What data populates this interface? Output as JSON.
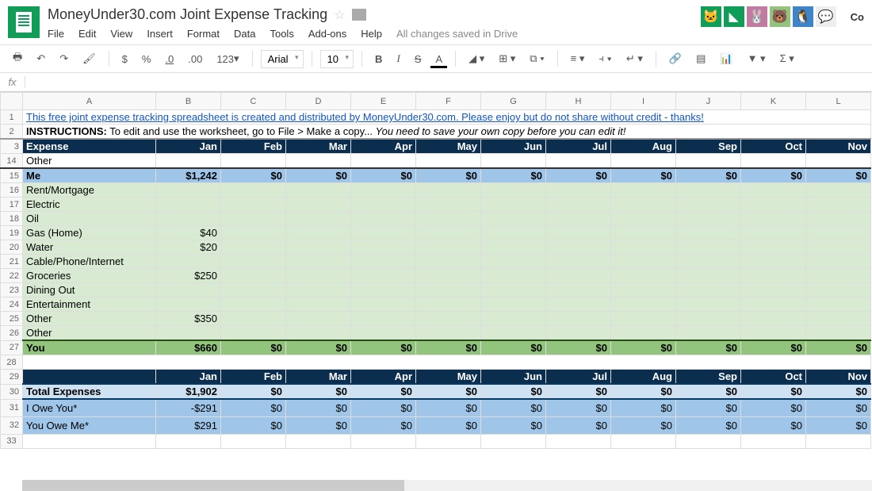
{
  "doc": {
    "title": "MoneyUnder30.com Joint Expense Tracking"
  },
  "menu": {
    "file": "File",
    "edit": "Edit",
    "view": "View",
    "insert": "Insert",
    "format": "Format",
    "data": "Data",
    "tools": "Tools",
    "addons": "Add-ons",
    "help": "Help",
    "status": "All changes saved in Drive"
  },
  "share": {
    "label": "Co"
  },
  "toolbar": {
    "currency": "$",
    "percent": "%",
    "dec0": ".0",
    "dec00": ".00",
    "fmt": "123",
    "font": "Arial",
    "size": "10",
    "bold": "B",
    "italic": "I",
    "strike": "S",
    "textcolor": "A"
  },
  "fx": {
    "label": "fx"
  },
  "columns": [
    "A",
    "B",
    "C",
    "D",
    "E",
    "F",
    "G",
    "H",
    "I",
    "J",
    "K",
    "L"
  ],
  "row1": {
    "link": "This free joint expense tracking spreadsheet is created and distributed by MoneyUnder30.com. Please enjoy but do not share without credit - thanks!"
  },
  "row2": {
    "bold": "INSTRUCTIONS:",
    "text": " To edit and use the worksheet, go to File > Make a copy...   ",
    "italic": "You need to save your own copy before you can edit it!"
  },
  "months": [
    "Jan",
    "Feb",
    "Mar",
    "Apr",
    "May",
    "Jun",
    "Jul",
    "Aug",
    "Sep",
    "Oct",
    "Nov"
  ],
  "header": {
    "expense": "Expense"
  },
  "r14": {
    "label": "Other"
  },
  "r15": {
    "label": "Me",
    "vals": [
      "$1,242",
      "$0",
      "$0",
      "$0",
      "$0",
      "$0",
      "$0",
      "$0",
      "$0",
      "$0",
      "$0"
    ]
  },
  "r16": {
    "label": "Rent/Mortgage"
  },
  "r17": {
    "label": "Electric"
  },
  "r18": {
    "label": "Oil"
  },
  "r19": {
    "label": "Gas (Home)",
    "jan": "$40"
  },
  "r20": {
    "label": "Water",
    "jan": "$20"
  },
  "r21": {
    "label": "Cable/Phone/Internet"
  },
  "r22": {
    "label": "Groceries",
    "jan": "$250"
  },
  "r23": {
    "label": "Dining Out"
  },
  "r24": {
    "label": "Entertainment"
  },
  "r25": {
    "label": "Other",
    "jan": "$350"
  },
  "r26": {
    "label": "Other"
  },
  "r27": {
    "label": "You",
    "vals": [
      "$660",
      "$0",
      "$0",
      "$0",
      "$0",
      "$0",
      "$0",
      "$0",
      "$0",
      "$0",
      "$0"
    ]
  },
  "r30": {
    "label": "Total Expenses",
    "vals": [
      "$1,902",
      "$0",
      "$0",
      "$0",
      "$0",
      "$0",
      "$0",
      "$0",
      "$0",
      "$0",
      "$0"
    ]
  },
  "r31": {
    "label": "I Owe You*",
    "vals": [
      "-$291",
      "$0",
      "$0",
      "$0",
      "$0",
      "$0",
      "$0",
      "$0",
      "$0",
      "$0",
      "$0"
    ]
  },
  "r32": {
    "label": "You Owe Me*",
    "vals": [
      "$291",
      "$0",
      "$0",
      "$0",
      "$0",
      "$0",
      "$0",
      "$0",
      "$0",
      "$0",
      "$0"
    ]
  },
  "rownums": {
    "r1": "1",
    "r2": "2",
    "r3": "3",
    "r14": "14",
    "r15": "15",
    "r16": "16",
    "r17": "17",
    "r18": "18",
    "r19": "19",
    "r20": "20",
    "r21": "21",
    "r22": "22",
    "r23": "23",
    "r24": "24",
    "r25": "25",
    "r26": "26",
    "r27": "27",
    "r28": "28",
    "r29": "29",
    "r30": "30",
    "r31": "31",
    "r32": "32",
    "r33": "33"
  }
}
